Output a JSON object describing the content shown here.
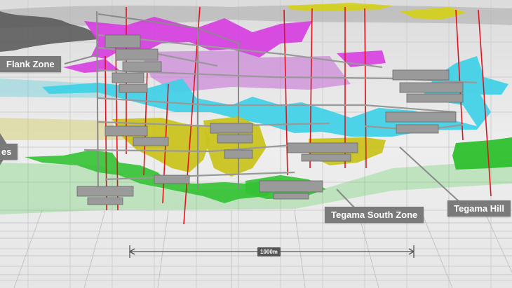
{
  "labels": {
    "flank_zone": "Flank Zone",
    "left_partial": "es",
    "tegama_south_zone": "Tegama South Zone",
    "tegama_hill": "Tegama Hill"
  },
  "scale_bar": {
    "text": "1000m"
  },
  "colors": {
    "magenta_zone": "#d63ee0",
    "cyan_zone": "#3fd0e6",
    "yellow_zone": "#c9c21a",
    "green_zone": "#33c233",
    "drillhole": "#e0141e",
    "mine_workings": "#9a9a9a"
  }
}
